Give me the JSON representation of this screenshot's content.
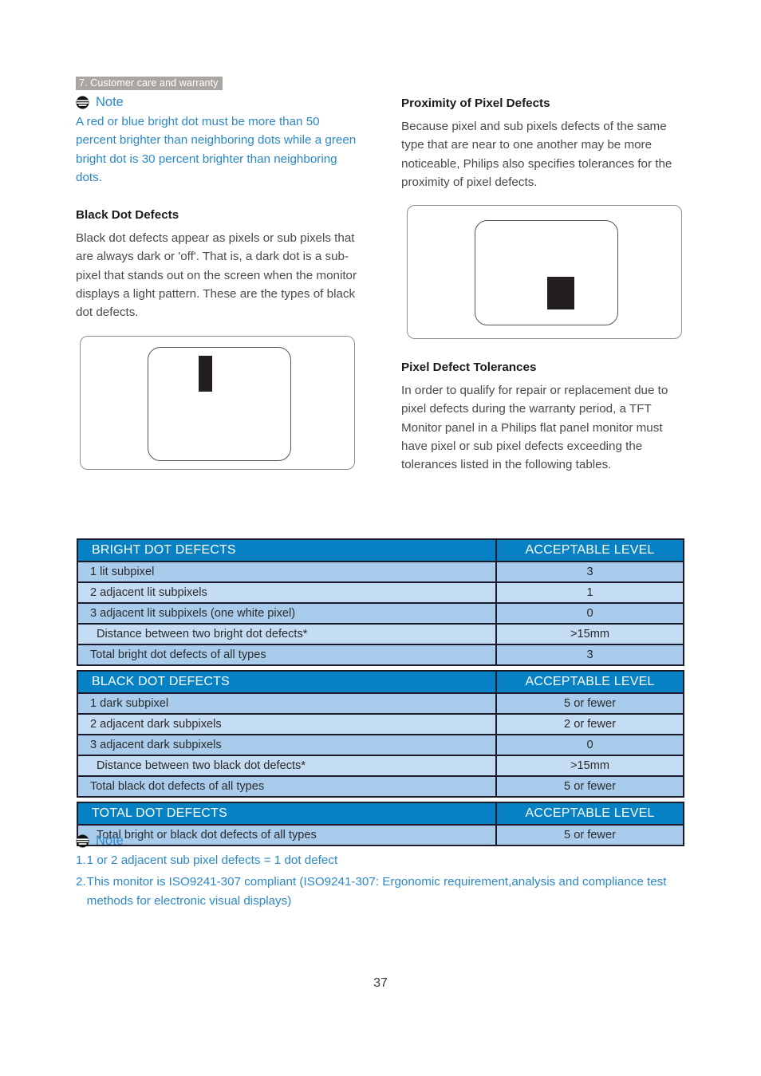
{
  "header": {
    "section_tag": "7. Customer care and warranty"
  },
  "note_top": {
    "icon": "note-icon",
    "label": "Note",
    "text": "A red or blue bright dot must be more than 50 percent brighter than neighboring dots while a green bright dot is 30 percent brighter than neighboring dots."
  },
  "left_column": {
    "heading": "Black Dot Defects",
    "paragraph": "Black dot defects appear as pixels or sub pixels that are always dark or 'off'. That is, a dark dot is a sub-pixel that stands out on the screen when the monitor displays a light pattern. These are the types of black dot defects.",
    "figure_name": "black-dot-defect-diagram"
  },
  "right_column": {
    "heading_1": "Proximity of Pixel Defects",
    "paragraph_1": "Because pixel and sub pixels defects of the same type that are near to one another may be more noticeable, Philips also specifies tolerances for the proximity of pixel defects.",
    "figure_name": "proximity-defect-diagram",
    "heading_2": "Pixel Defect Tolerances",
    "paragraph_2": "In order to qualify for repair or replacement due to pixel defects during the warranty period, a TFT Monitor panel in a Philips flat panel monitor must have pixel or sub pixel defects exceeding the tolerances listed in the following tables."
  },
  "tables": [
    {
      "id": "bright-dot-defects",
      "header_left": "BRIGHT DOT DEFECTS",
      "header_right": "ACCEPTABLE LEVEL",
      "rows": [
        {
          "label": "1 lit subpixel",
          "value": "3",
          "indent": false
        },
        {
          "label": "2 adjacent lit subpixels",
          "value": "1",
          "indent": false
        },
        {
          "label": "3 adjacent lit subpixels (one white pixel)",
          "value": "0",
          "indent": false
        },
        {
          "label": "Distance between two bright dot defects*",
          "value": ">15mm",
          "indent": true
        },
        {
          "label": "Total bright dot defects of all types",
          "value": "3",
          "indent": false
        }
      ]
    },
    {
      "id": "black-dot-defects",
      "header_left": "BLACK DOT DEFECTS",
      "header_right": "ACCEPTABLE LEVEL",
      "rows": [
        {
          "label": "1 dark subpixel",
          "value": "5 or fewer",
          "indent": false
        },
        {
          "label": "2 adjacent dark subpixels",
          "value": "2 or fewer",
          "indent": false
        },
        {
          "label": "3 adjacent dark subpixels",
          "value": "0",
          "indent": false
        },
        {
          "label": "Distance between two black dot defects*",
          "value": ">15mm",
          "indent": true
        },
        {
          "label": "Total black dot defects of all types",
          "value": "5 or fewer",
          "indent": false
        }
      ]
    },
    {
      "id": "total-dot-defects",
      "header_left": "TOTAL DOT DEFECTS",
      "header_right": "ACCEPTABLE LEVEL",
      "rows": [
        {
          "label": "Total bright or black dot defects of all types",
          "value": "5 or fewer",
          "indent": true
        }
      ]
    }
  ],
  "note_bottom": {
    "icon": "note-icon",
    "label": "Note",
    "items": [
      {
        "num": "1.",
        "text": "1 or 2 adjacent sub pixel defects = 1 dot defect"
      },
      {
        "num": "2.",
        "text": "This monitor is ISO9241-307 compliant (ISO9241-307: Ergonomic requirement,analysis and compliance test methods for electronic visual displays)"
      }
    ]
  },
  "footer": {
    "page_number": "37"
  },
  "colors": {
    "section_tag_bg": "#a9a6a1",
    "note_blue": "#2b88c8",
    "table_header_blue": "#0581c4",
    "row_odd": "#a9cced",
    "row_even": "#c4dcf4",
    "table_border": "#1b1b2b",
    "dot_black": "#231f20"
  }
}
